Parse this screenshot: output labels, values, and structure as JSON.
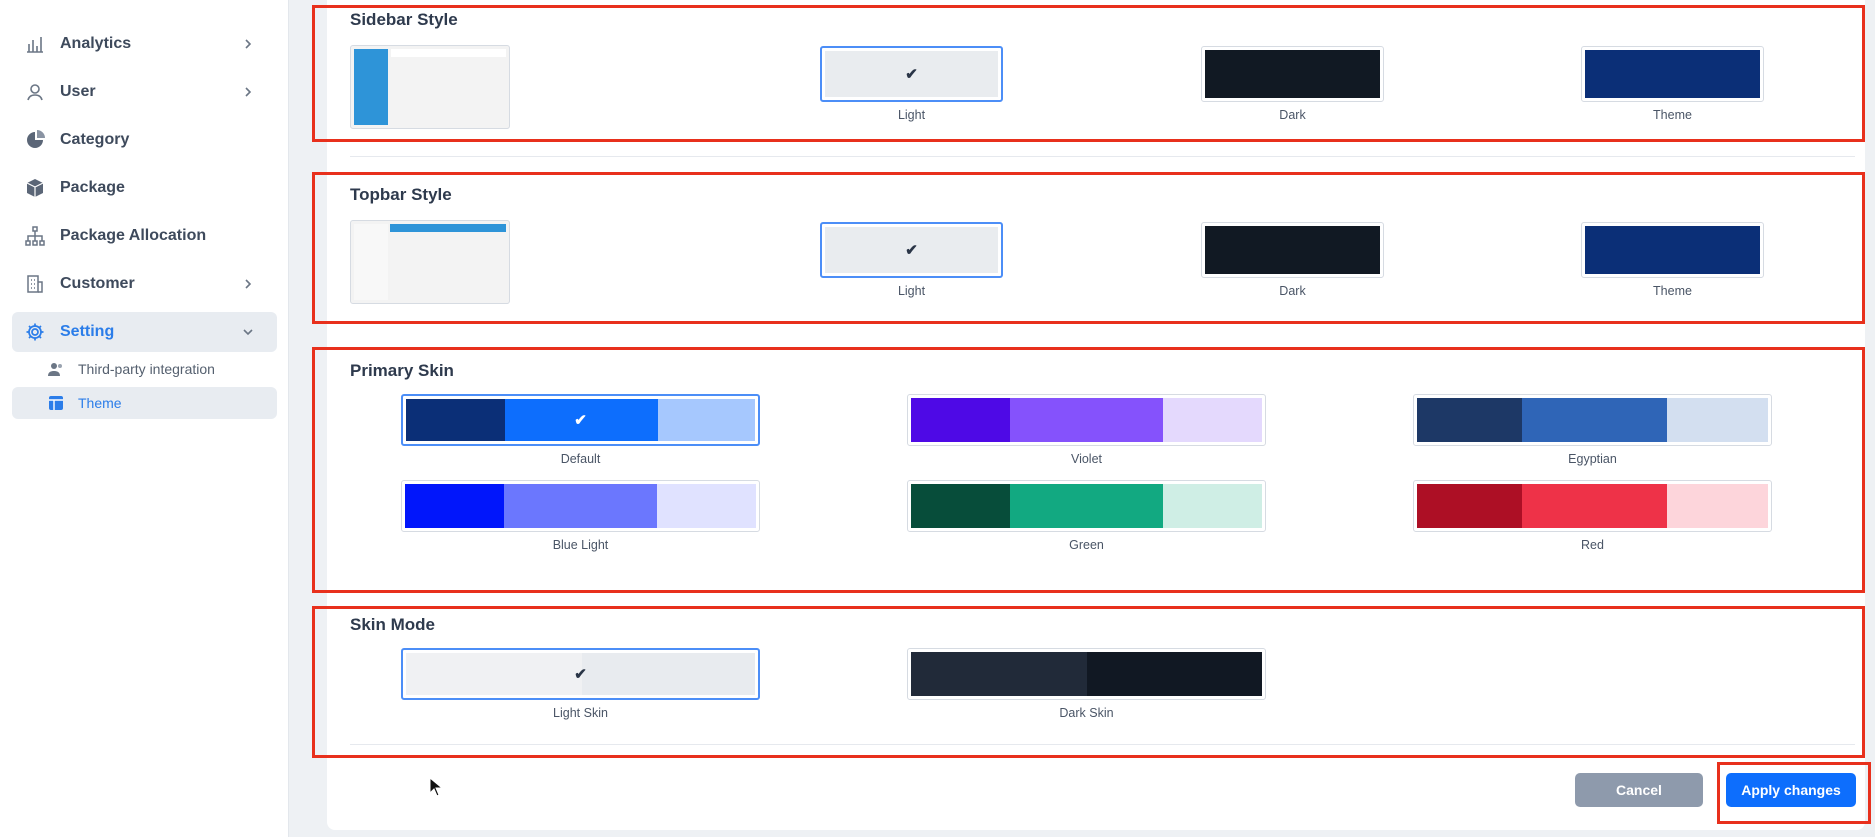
{
  "sidebar": {
    "items": [
      {
        "label": "Analytics",
        "icon": "bar-chart-icon",
        "chevron": "right"
      },
      {
        "label": "User",
        "icon": "user-icon",
        "chevron": "right"
      },
      {
        "label": "Category",
        "icon": "pie-chart-icon"
      },
      {
        "label": "Package",
        "icon": "box-icon"
      },
      {
        "label": "Package Allocation",
        "icon": "hierarchy-icon"
      },
      {
        "label": "Customer",
        "icon": "building-icon",
        "chevron": "right"
      },
      {
        "label": "Setting",
        "icon": "gear-icon",
        "chevron": "down",
        "active": true
      }
    ],
    "subitems": [
      {
        "label": "Third-party integration",
        "icon": "users-icon"
      },
      {
        "label": "Theme",
        "icon": "layout-icon",
        "active": true
      }
    ]
  },
  "sidebar_style": {
    "title": "Sidebar Style",
    "options": [
      {
        "label": "Light",
        "color": "#e9ecef",
        "selected": true
      },
      {
        "label": "Dark",
        "color": "#111923"
      },
      {
        "label": "Theme",
        "color": "#0b2f77"
      }
    ]
  },
  "topbar_style": {
    "title": "Topbar Style",
    "options": [
      {
        "label": "Light",
        "color": "#e9ecef",
        "selected": true
      },
      {
        "label": "Dark",
        "color": "#111923"
      },
      {
        "label": "Theme",
        "color": "#0b2f77"
      }
    ]
  },
  "primary_skin": {
    "title": "Primary Skin",
    "options": [
      {
        "label": "Default",
        "colors": [
          "#0b2f77",
          "#0d6efd",
          "#a6c8fe"
        ],
        "selected": true
      },
      {
        "label": "Violet",
        "colors": [
          "#4e09e6",
          "#8552fc",
          "#e4d9fd"
        ]
      },
      {
        "label": "Egyptian",
        "colors": [
          "#1d3866",
          "#2f65b7",
          "#d3dff0"
        ]
      },
      {
        "label": "Blue Light",
        "colors": [
          "#0116fb",
          "#6b77fe",
          "#e0e2ff"
        ]
      },
      {
        "label": "Green",
        "colors": [
          "#074d3a",
          "#12a981",
          "#cfeee5"
        ]
      },
      {
        "label": "Red",
        "colors": [
          "#ad0f25",
          "#ee3248",
          "#fdd5db"
        ]
      }
    ]
  },
  "skin_mode": {
    "title": "Skin Mode",
    "options": [
      {
        "label": "Light Skin",
        "colors": [
          "#f0f1f3",
          "#e8ebef"
        ],
        "selected": true
      },
      {
        "label": "Dark Skin",
        "colors": [
          "#212a39",
          "#111823"
        ]
      }
    ]
  },
  "buttons": {
    "cancel": "Cancel",
    "apply": "Apply changes"
  },
  "colors": {
    "accent": "#2b7de9",
    "apply_button": "#0d6efd",
    "cancel_button": "#8e9aac",
    "annotation": "#e8301c"
  }
}
